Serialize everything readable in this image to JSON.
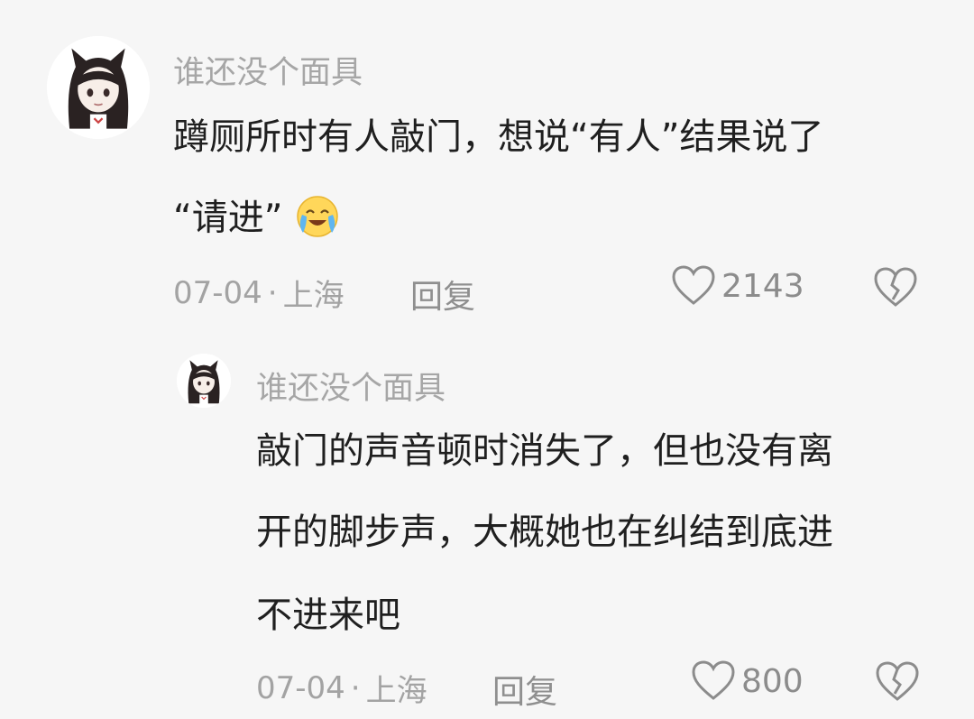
{
  "comments": [
    {
      "username": "谁还没个面具",
      "text_lines": [
        "蹲厕所时有人敲门，想说“有人”结果说了",
        "“请进”"
      ],
      "emoji": "crying-laughing-emoji",
      "date": "07-04",
      "separator": "·",
      "location": "上海",
      "reply_label": "回复",
      "likes": "2143"
    },
    {
      "username": "谁还没个面具",
      "text_lines": [
        "敲门的声音顿时消失了，但也没有离",
        "开的脚步声，大概她也在纠结到底进",
        "不进来吧"
      ],
      "date": "07-04",
      "separator": "·",
      "location": "上海",
      "reply_label": "回复",
      "likes": "800"
    }
  ],
  "icons": {
    "like": "heart-outline-icon",
    "dislike": "broken-heart-icon"
  },
  "colors": {
    "background": "#f6f6f6",
    "text": "#1f1f1f",
    "meta": "#a3a3a3"
  }
}
